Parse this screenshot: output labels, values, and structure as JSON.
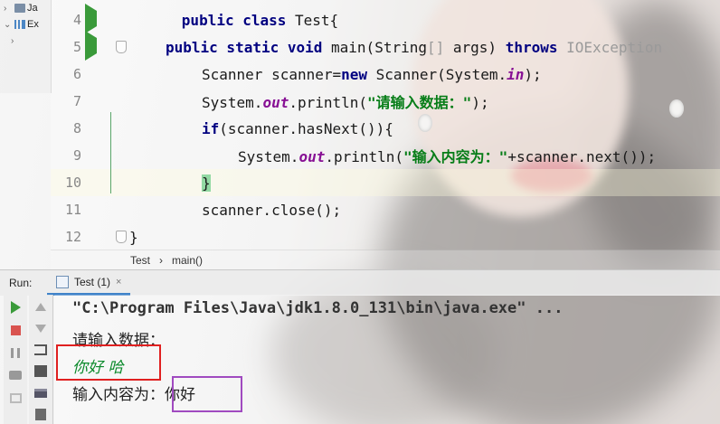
{
  "project_tree": {
    "rows": [
      {
        "chevron": "›",
        "label": "Ja"
      },
      {
        "chevron": "⌄",
        "label": "Ex"
      },
      {
        "chevron": "",
        "label": ""
      }
    ]
  },
  "editor": {
    "lines": [
      {
        "num": "4"
      },
      {
        "num": "5"
      },
      {
        "num": "6"
      },
      {
        "num": "7"
      },
      {
        "num": "8"
      },
      {
        "num": "9"
      },
      {
        "num": "10"
      },
      {
        "num": "11"
      },
      {
        "num": "12"
      }
    ],
    "code": {
      "l4_kw": "public class",
      "l4_name": " Test{",
      "l5_kw": "public static void",
      "l5_mid": " main(String",
      "l5_brackets": "[]",
      "l5_args": " args) ",
      "l5_throws": "throws",
      "l5_exc": " IOException",
      "l6_a": "Scanner scanner=",
      "l6_new": "new",
      "l6_b": " Scanner(System.",
      "l6_fld": "in",
      "l6_c": ");",
      "l7_a": "System.",
      "l7_fld": "out",
      "l7_b": ".println(",
      "l7_str": "\"请输入数据：\"",
      "l7_c": ");",
      "l8_if": "if",
      "l8_a": "(scanner.hasNext()){",
      "l9_a": "System.",
      "l9_fld": "out",
      "l9_b": ".println(",
      "l9_str": "\"输入内容为：\"",
      "l9_c": "+scanner.next());",
      "l10_brace": "}",
      "l11_a": "scanner.close();",
      "l12_a": "}"
    },
    "breadcrumb": [
      "Test",
      "main()"
    ]
  },
  "run_panel": {
    "label": "Run:",
    "tab_label": "Test (1)",
    "tab_close": "×"
  },
  "console": {
    "command": "\"C:\\Program Files\\Java\\jdk1.8.0_131\\bin\\java.exe\" ...",
    "prompt": "请输入数据：",
    "user_input": "你好 哈",
    "output": "输入内容为：你好"
  },
  "colors": {
    "keyword": "#000080",
    "string": "#067d17",
    "field": "#871094",
    "run_green": "#3a9a3a",
    "highlight_red": "#e02020",
    "highlight_purple": "#a04ac0"
  }
}
